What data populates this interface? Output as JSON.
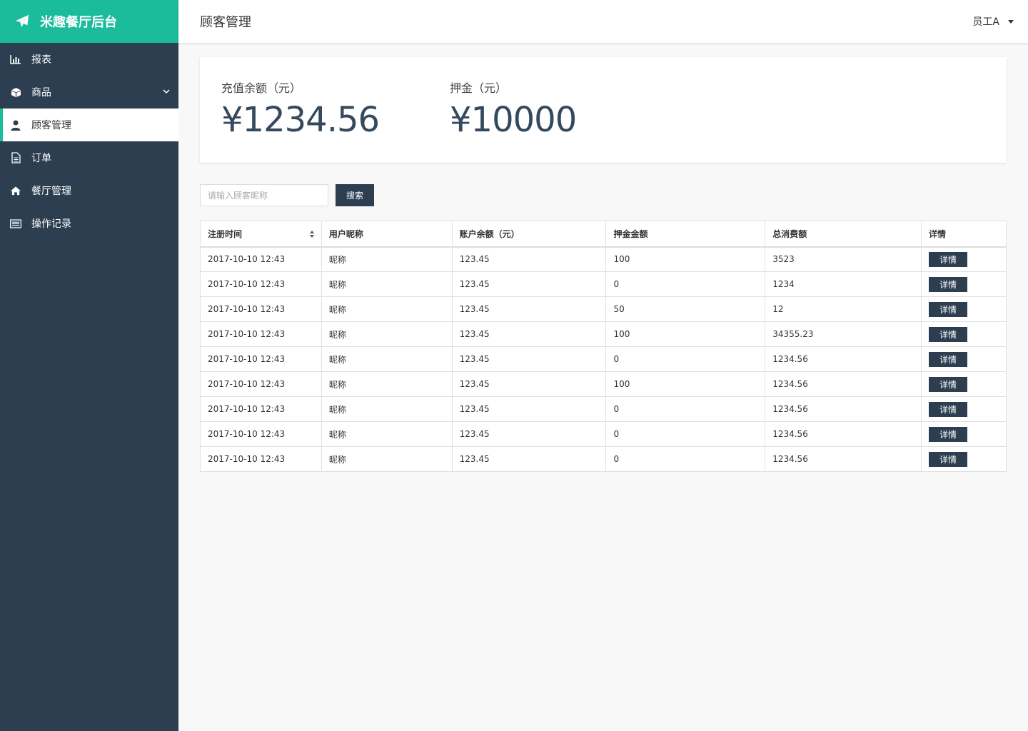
{
  "app": {
    "title": "米趣餐厅后台"
  },
  "sidebar": {
    "items": [
      {
        "label": "报表",
        "icon": "bar-chart-icon"
      },
      {
        "label": "商品",
        "icon": "cube-icon"
      },
      {
        "label": "顾客管理",
        "icon": "user-icon"
      },
      {
        "label": "订单",
        "icon": "document-icon"
      },
      {
        "label": "餐厅管理",
        "icon": "home-icon"
      },
      {
        "label": "操作记录",
        "icon": "list-icon"
      }
    ],
    "active": "顾客管理"
  },
  "header": {
    "title": "顾客管理",
    "user": "员工A"
  },
  "stats": [
    {
      "label": "充值余额（元）",
      "value": "¥1234.56"
    },
    {
      "label": "押金（元）",
      "value": "¥10000"
    }
  ],
  "search": {
    "placeholder": "请输入顾客昵称",
    "button": "搜索"
  },
  "table": {
    "columns": [
      "注册时间",
      "用户昵称",
      "账户余额（元）",
      "押金金额",
      "总消费额",
      "详情"
    ],
    "rows": [
      [
        "2017-10-10 12:43",
        "昵称",
        "123.45",
        "100",
        "3523"
      ],
      [
        "2017-10-10 12:43",
        "昵称",
        "123.45",
        "0",
        "1234"
      ],
      [
        "2017-10-10 12:43",
        "昵称",
        "123.45",
        "50",
        "12"
      ],
      [
        "2017-10-10 12:43",
        "昵称",
        "123.45",
        "100",
        "34355.23"
      ],
      [
        "2017-10-10 12:43",
        "昵称",
        "123.45",
        "0",
        "1234.56"
      ],
      [
        "2017-10-10 12:43",
        "昵称",
        "123.45",
        "100",
        "1234.56"
      ],
      [
        "2017-10-10 12:43",
        "昵称",
        "123.45",
        "0",
        "1234.56"
      ],
      [
        "2017-10-10 12:43",
        "昵称",
        "123.45",
        "0",
        "1234.56"
      ],
      [
        "2017-10-10 12:43",
        "昵称",
        "123.45",
        "0",
        "1234.56"
      ]
    ],
    "detail_label": "详情"
  },
  "colors": {
    "sidebar": "#2c3e50",
    "accent": "#1abc9c",
    "button": "#2c3e50"
  }
}
